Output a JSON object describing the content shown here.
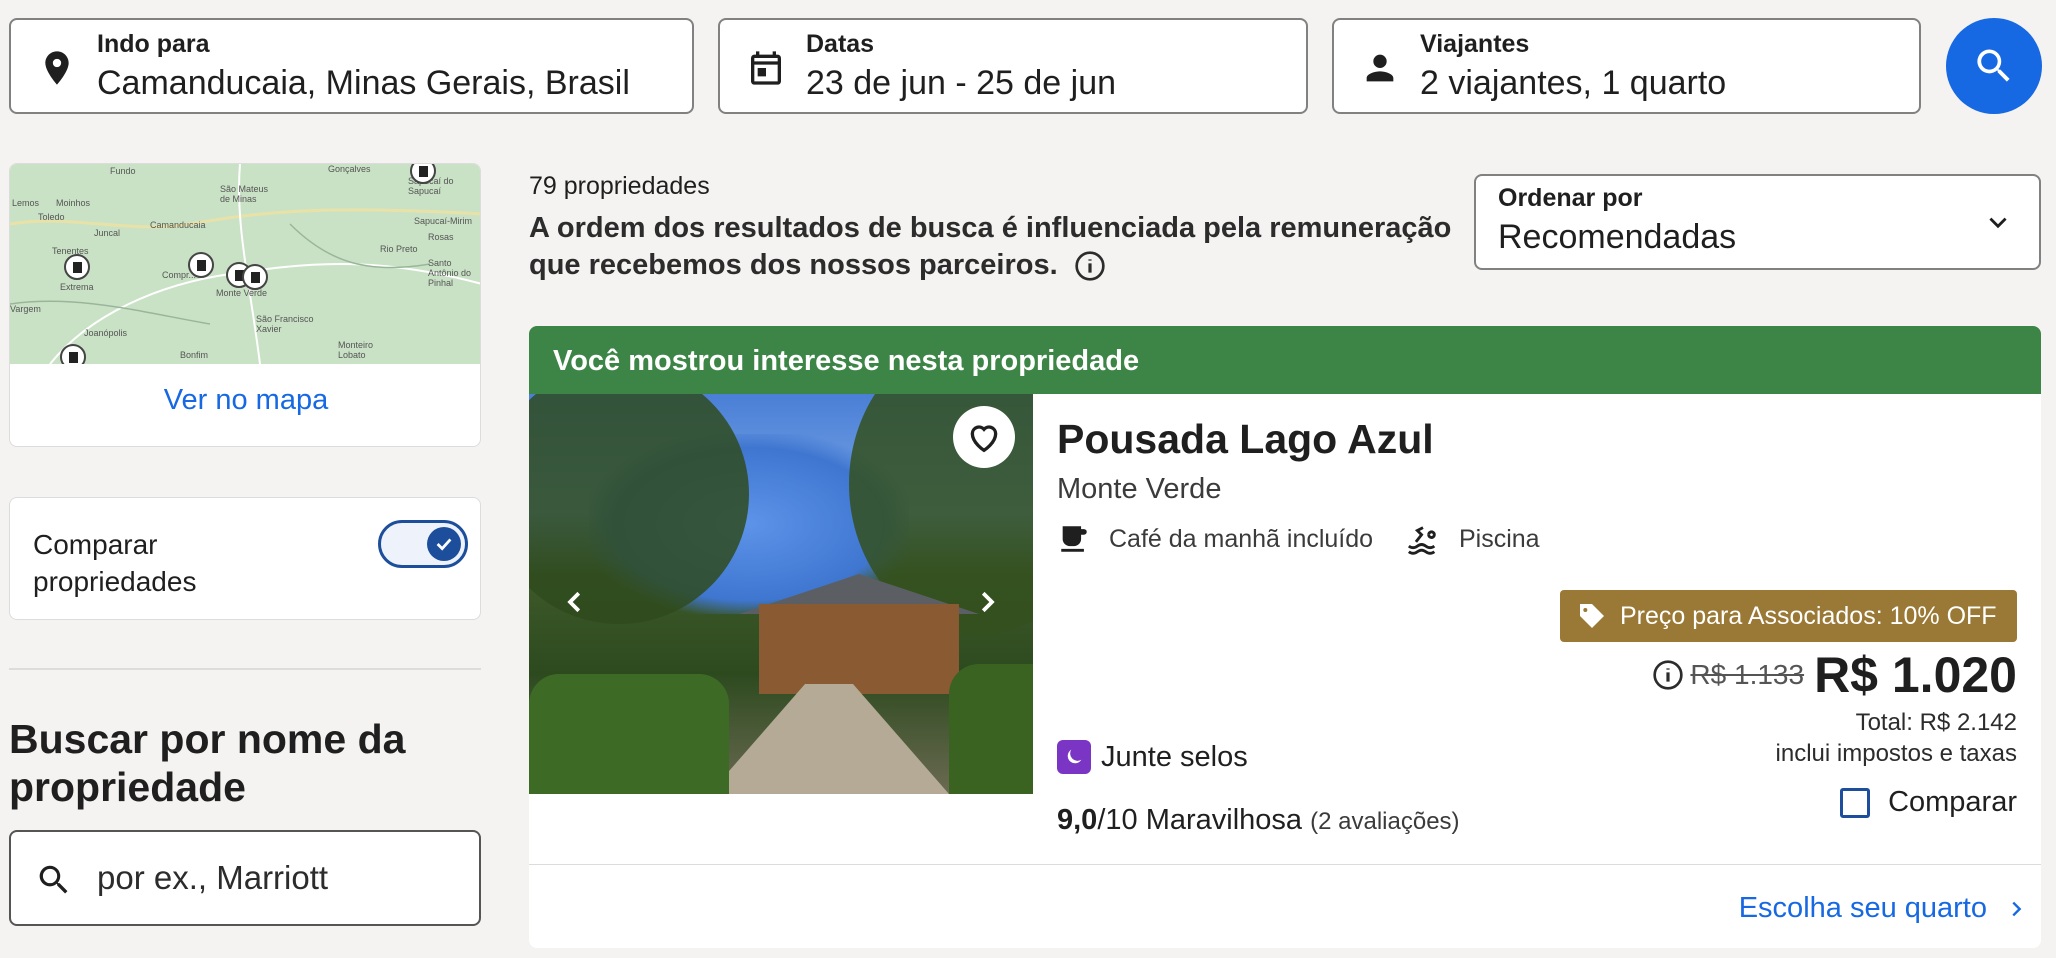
{
  "search": {
    "destination": {
      "label": "Indo para",
      "value": "Camanducaia, Minas Gerais, Brasil",
      "icon": "location-pin-icon"
    },
    "dates": {
      "label": "Datas",
      "value": "23 de jun - 25 de jun",
      "icon": "calendar-icon"
    },
    "travelers": {
      "label": "Viajantes",
      "value": "2 viajantes, 1 quarto",
      "icon": "person-icon"
    },
    "button_icon": "search-icon"
  },
  "sidebar": {
    "map": {
      "link": "Ver no mapa",
      "place_labels": [
        "Fundo",
        "São Mateus de Minas",
        "Gonçalves",
        "Sapucaí do Sapucaí",
        "Lemos",
        "Moinhos",
        "Toledo",
        "Juncal",
        "Camanducaia",
        "Sapucaí-Mirim",
        "Rosas",
        "Tenentes",
        "Extrema",
        "Rio Preto",
        "Santo Antônio do Pinhal",
        "Vargem",
        "Joanópolis",
        "São Francisco Xavier",
        "Monteiro Lobato",
        "Bonfim",
        "Monte Verde",
        "Compr..."
      ]
    },
    "compare": {
      "label": "Comparar propriedades",
      "enabled": true
    },
    "name_search": {
      "title": "Buscar por nome da propriedade",
      "placeholder": "por ex., Marriott"
    }
  },
  "results": {
    "count": "79 propriedades",
    "disclaimer": "A ordem dos resultados de busca é influenciada pela remuneração que recebemos dos nossos parceiros.",
    "sort": {
      "label": "Ordenar por",
      "value": "Recomendadas"
    }
  },
  "property": {
    "banner": "Você mostrou interesse nesta propriedade",
    "name": "Pousada Lago Azul",
    "location": "Monte Verde",
    "amenities": [
      {
        "label": "Café da manhã incluído",
        "icon": "coffee-cup-icon"
      },
      {
        "label": "Piscina",
        "icon": "pool-icon"
      }
    ],
    "deal_badge": "Preço para Associados: 10% OFF",
    "old_price": "R$ 1.133",
    "price": "R$ 1.020",
    "total": "Total: R$ 2.142",
    "taxes": "inclui impostos e taxas",
    "compare_label": "Comparar",
    "loyalty": "Junte selos",
    "rating": {
      "score": "9,0",
      "scale": "/10",
      "descriptor": "Maravilhosa",
      "reviews": "(2 avaliações)"
    },
    "cta": "Escolha seu quarto"
  },
  "colors": {
    "primary": "#1668e3",
    "banner_green": "#3c8546",
    "deal_gold": "#9a7835",
    "loyalty_purple": "#7b35c4",
    "toggle_navy": "#1c4e9b"
  }
}
